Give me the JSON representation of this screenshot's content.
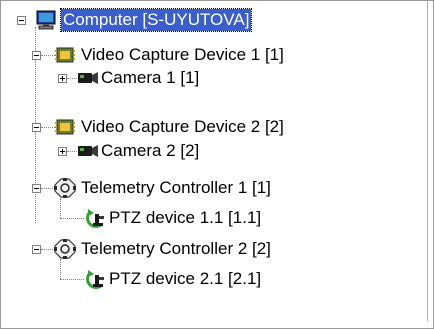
{
  "tree": {
    "root": {
      "label": "Computer [S-UYUTOVA]",
      "icon": "computer-icon",
      "expanded": true,
      "selected": true
    },
    "items": [
      {
        "label": "Video Capture Device 1 [1]",
        "icon": "video-capture-card-icon",
        "expanded": true
      },
      {
        "label": "Camera 1 [1]",
        "icon": "camera-icon",
        "expanded": false
      },
      {
        "label": "Video Capture Device 2 [2]",
        "icon": "video-capture-card-icon",
        "expanded": true
      },
      {
        "label": "Camera 2 [2]",
        "icon": "camera-icon",
        "expanded": false
      },
      {
        "label": "Telemetry Controller 1 [1]",
        "icon": "telemetry-controller-icon",
        "expanded": true
      },
      {
        "label": "PTZ device 1.1 [1.1]",
        "icon": "ptz-device-icon"
      },
      {
        "label": "Telemetry Controller 2 [2]",
        "icon": "telemetry-controller-icon",
        "expanded": true
      },
      {
        "label": "PTZ device 2.1 [2.1]",
        "icon": "ptz-device-icon"
      }
    ]
  },
  "colors": {
    "selection": "#3a5fcd",
    "connector": "#808080",
    "border": "#9a9a9a"
  }
}
